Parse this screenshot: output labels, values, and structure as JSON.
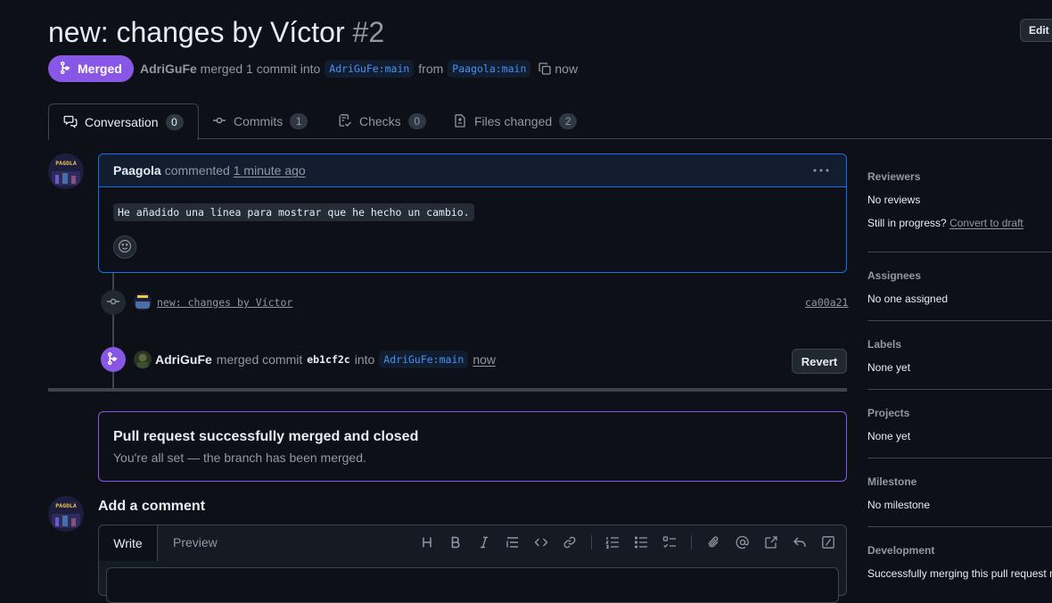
{
  "header": {
    "title": "new: changes by Víctor",
    "number": "#2",
    "edit_label": "Edit",
    "state": "Merged",
    "author": "AdriGuFe",
    "merged_text": "merged 1 commit into",
    "base_branch": "AdriGuFe:main",
    "from_text": "from",
    "head_branch": "Paagola:main",
    "time": "now"
  },
  "tabs": [
    {
      "label": "Conversation",
      "count": "0"
    },
    {
      "label": "Commits",
      "count": "1"
    },
    {
      "label": "Checks",
      "count": "0"
    },
    {
      "label": "Files changed",
      "count": "2"
    }
  ],
  "comment": {
    "author": "Paagola",
    "action": "commented",
    "time": "1 minute ago",
    "body": "He añadido una línea para mostrar que he hecho un cambio.",
    "avatar_text": "PAGOLA"
  },
  "commit": {
    "message": "new: changes by Víctor",
    "sha": "ca00a21"
  },
  "merge_event": {
    "author": "AdriGuFe",
    "text": "merged commit",
    "sha": "eb1cf2c",
    "into": "into",
    "branch": "AdriGuFe:main",
    "time": "now",
    "revert_label": "Revert"
  },
  "merged_box": {
    "title": "Pull request successfully merged and closed",
    "subtitle": "You're all set — the branch has been merged."
  },
  "add_comment": {
    "title": "Add a comment",
    "write_tab": "Write",
    "preview_tab": "Preview"
  },
  "sidebar": {
    "reviewers_title": "Reviewers",
    "reviewers_value": "No reviews",
    "in_progress_text": "Still in progress?",
    "convert_link": "Convert to draft",
    "assignees_title": "Assignees",
    "assignees_value": "No one assigned",
    "labels_title": "Labels",
    "labels_value": "None yet",
    "projects_title": "Projects",
    "projects_value": "None yet",
    "milestone_title": "Milestone",
    "milestone_value": "No milestone",
    "development_title": "Development",
    "development_value": "Successfully merging this pull request may close these issues."
  },
  "colors": {
    "background": "#0d1117",
    "merged_purple": "#8957e5",
    "comment_border": "#1f6feb",
    "link_blue": "#4493f8"
  }
}
